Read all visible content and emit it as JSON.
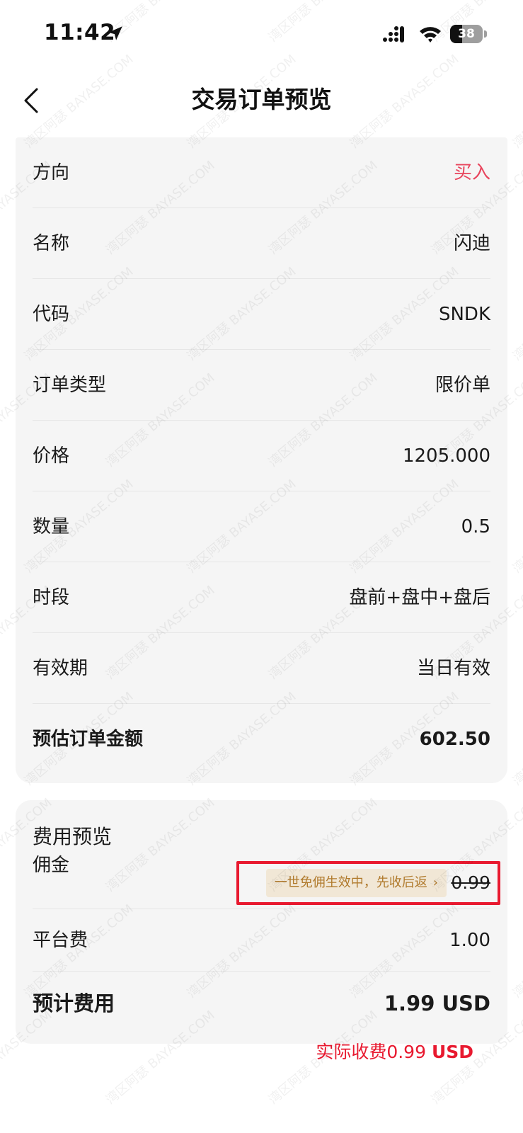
{
  "status_bar": {
    "time": "11:42",
    "battery_level": "38",
    "battery_fraction": 0.38
  },
  "nav": {
    "title": "交易订单预览",
    "back_icon": "chevron-left-icon"
  },
  "order": {
    "rows": [
      {
        "label": "方向",
        "value": "买入"
      },
      {
        "label": "名称",
        "value": "闪迪"
      },
      {
        "label": "代码",
        "value": "SNDK"
      },
      {
        "label": "订单类型",
        "value": "限价单"
      },
      {
        "label": "价格",
        "value": "1205.000"
      },
      {
        "label": "数量",
        "value": "0.5"
      },
      {
        "label": "时段",
        "value": "盘前+盘中+盘后"
      },
      {
        "label": "有效期",
        "value": "当日有效"
      },
      {
        "label": "预估订单金额",
        "value": "602.50"
      }
    ]
  },
  "fees": {
    "title": "费用预览",
    "commission_label": "佣金",
    "commission_promo": "一世免佣生效中，先收后返",
    "commission_promo_chevron": "›",
    "commission_value": "0.99",
    "platform_label": "平台费",
    "platform_value": "1.00",
    "total_label": "预计费用",
    "total_value": "1.99 USD"
  },
  "annotation": {
    "actual_charge_text": "实际收费0.99",
    "actual_charge_unit": "USD"
  },
  "watermark_text": "湾区阿瑟 BAYASE.COM",
  "colors": {
    "buy": "#e8455d",
    "annotation_red": "#e8192f",
    "promo_bg": "#f1e7d6",
    "promo_text": "#b07a2c",
    "card_bg": "#f5f5f5"
  }
}
